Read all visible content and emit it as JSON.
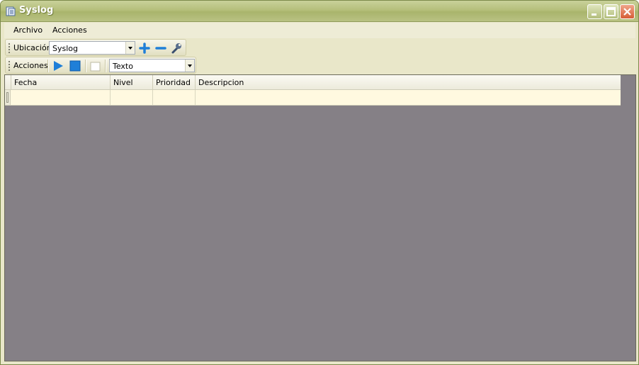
{
  "window": {
    "title": "Syslog"
  },
  "menu": {
    "items": [
      "Archivo",
      "Acciones"
    ]
  },
  "toolbar_location": {
    "label": "Ubicación",
    "combo_value": "Syslog",
    "buttons": {
      "add": "plus-icon",
      "remove": "minus-icon",
      "settings": "wrench-icon"
    }
  },
  "toolbar_actions": {
    "label": "Acciones",
    "buttons": {
      "play": "play-icon",
      "stop": "stop-icon",
      "check": "checkbox-icon"
    },
    "combo_value": "Texto"
  },
  "grid": {
    "columns": [
      "Fecha",
      "Nivel",
      "Prioridad",
      "Descripcion"
    ]
  },
  "colors": {
    "titlebar": "#b5bf7b",
    "window_bg": "#e9e7c9",
    "content_bg": "#858086",
    "row_bg": "#fff9e0",
    "accent_blue": "#1f7fd8"
  }
}
